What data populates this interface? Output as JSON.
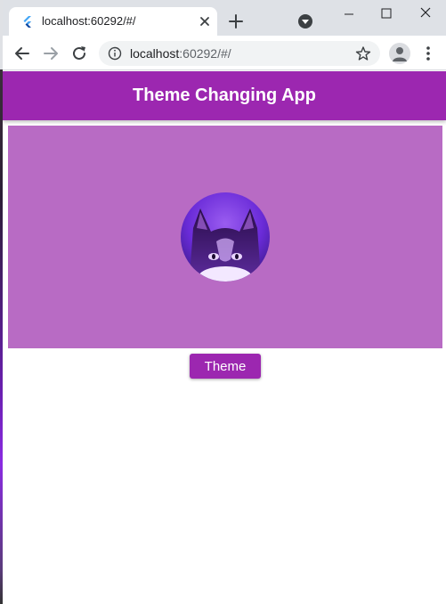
{
  "browser": {
    "tab": {
      "title": "localhost:60292/#/",
      "favicon": "flutter-icon"
    },
    "address_bar": {
      "host": "localhost",
      "rest": ":60292/#/"
    },
    "icons": [
      "back-arrow-icon",
      "forward-arrow-icon",
      "reload-icon",
      "info-icon",
      "star-icon",
      "profile-icon",
      "more-vert-icon",
      "close-icon",
      "plus-icon",
      "minimize-icon",
      "maximize-icon"
    ]
  },
  "app": {
    "title": "Theme Changing App",
    "theme_button_label": "Theme",
    "image": "cat-avatar"
  },
  "colors": {
    "primary": "#9c27b0",
    "hero_background": "#b86bc4",
    "tab_strip": "#dee1e6"
  }
}
